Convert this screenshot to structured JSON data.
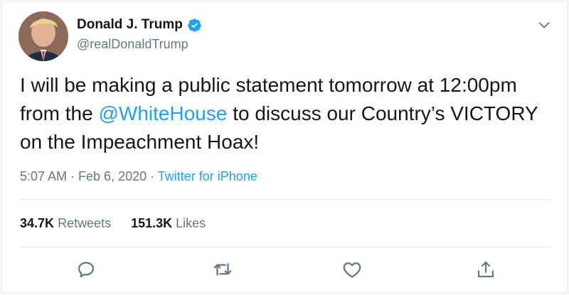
{
  "user": {
    "display_name": "Donald J. Trump",
    "handle": "@realDonaldTrump",
    "verified": true
  },
  "tweet": {
    "text_part1": "I will be making a public statement tomorrow at 12:00pm from the ",
    "mention": "@WhiteHouse",
    "text_part2": " to discuss our Country’s VICTORY on the Impeachment Hoax!",
    "time": "5:07 AM · Feb 6, 2020 · ",
    "source": "Twitter for iPhone"
  },
  "stats": {
    "retweets_count": "34.7K",
    "retweets_label": "Retweets",
    "likes_count": "151.3K",
    "likes_label": "Likes"
  },
  "colors": {
    "accent": "#1da1f2",
    "text": "#14171a",
    "muted": "#657786",
    "border": "#e1e8ed"
  },
  "icons": [
    "verified-badge-icon",
    "chevron-down-icon",
    "reply-icon",
    "retweet-icon",
    "like-icon",
    "share-icon"
  ]
}
